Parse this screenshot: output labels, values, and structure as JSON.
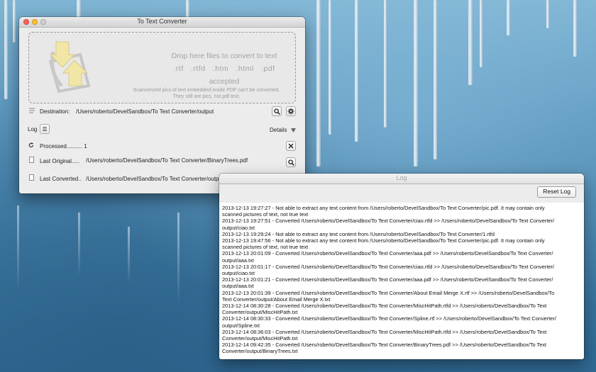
{
  "main_window": {
    "title": "To Text Converter",
    "drop_text": "Drop here files to convert to text",
    "drop_extensions": ".rtf   .rtfd   .htm   .html   .pdf",
    "drop_accepted": "accepted",
    "drop_note_line1": "Scannerized pics of text embedded inside PDF can't be converted.",
    "drop_note_line2": "They still are pics, not pdf text.",
    "destination_label": "Destination:",
    "destination_path": "/Users/roberto/DevelSandbox/To Text Converter/output",
    "log_label": "Log",
    "details_label": "Details",
    "processed_label": "Processed.......... 1",
    "last_original_label": "Last Original.....",
    "last_original_path": "/Users/roberto/DevelSandbox/To Text Converter/BinaryTrees.pdf",
    "last_converted_label": "Last Converted..",
    "last_converted_path": "/Users/roberto/DevelSandbox/To Text Converter/output/BinaryTrees.txt"
  },
  "log_window": {
    "title": "Log",
    "reset_label": "Reset Log",
    "lines": [
      "2013-12-13 19:27:27 - Not able to extract any text content from /Users/roberto/DevelSandbox/To Text Converter/pic.pdf. It may contain only",
      "scanned pictures of text, not true text",
      "2013-12-13 19:27:51 - Converted /Users/roberto/DevelSandbox/To Text Converter/ciao.rtfd  >>  /Users/roberto/DevelSandbox/To Text Converter/",
      "output/ciao.txt",
      "2013-12-13 19:29:24 - Not able to extract any text content from /Users/roberto/DevelSandbox/To Text Converter/1.rtfd",
      "2013-12-13 19:47:56 - Not able to extract any text content from /Users/roberto/DevelSandbox/To Text Converter/pic.pdf. It may contain only",
      "scanned pictures of text, not true text",
      "2013-12-13 20:01:09 - Converted /Users/roberto/DevelSandbox/To Text Converter/aaa.pdf  >>  /Users/roberto/DevelSandbox/To Text Converter/",
      "output/aaa.txt",
      "2013-12-13 20:01:17 - Converted /Users/roberto/DevelSandbox/To Text Converter/ciao.rtfd  >>  /Users/roberto/DevelSandbox/To Text Converter/",
      "output/ciao.txt",
      "2013-12-13 20:01:21 - Converted /Users/roberto/DevelSandbox/To Text Converter/aaa.pdf  >>  /Users/roberto/DevelSandbox/To Text Converter/",
      "output/aaa.txt",
      "2013-12-13 20:01:39 - Converted /Users/roberto/DevelSandbox/To Text Converter/About Email Merge X.rtf  >>  /Users/roberto/DevelSandbox/To",
      "Text Converter/output/About Email Merge X.txt",
      "2013-12-14 08:30:28 - Converted /Users/roberto/DevelSandbox/To Text Converter/MiscHitPath.rtfd  >>  /Users/roberto/DevelSandbox/To Text",
      "Converter/output/MiscHitPath.txt",
      "2013-12-14 08:30:33 - Converted /Users/roberto/DevelSandbox/To Text Converter/Spline.rtf  >>  /Users/roberto/DevelSandbox/To Text Converter/",
      "output/Spline.txt",
      "2013-12-14 08:36:03 - Converted /Users/roberto/DevelSandbox/To Text Converter/MiscHitPath.rtfd  >>  /Users/roberto/DevelSandbox/To Text",
      "Converter/output/MiscHitPath.txt",
      "2013-12-14 09:42:35 - Converted /Users/roberto/DevelSandbox/To Text Converter/BinaryTrees.pdf  >>  /Users/roberto/DevelSandbox/To Text",
      "Converter/output/BinaryTrees.txt"
    ]
  },
  "icons": {
    "drop": "convert-arrows-icon",
    "destination": "lines-icon",
    "search": "magnifier-icon",
    "settings": "gear-icon",
    "log_toggle": "list-icon",
    "details": "triangle-down-icon",
    "refresh": "refresh-icon",
    "clear": "close-icon",
    "file": "document-icon"
  }
}
